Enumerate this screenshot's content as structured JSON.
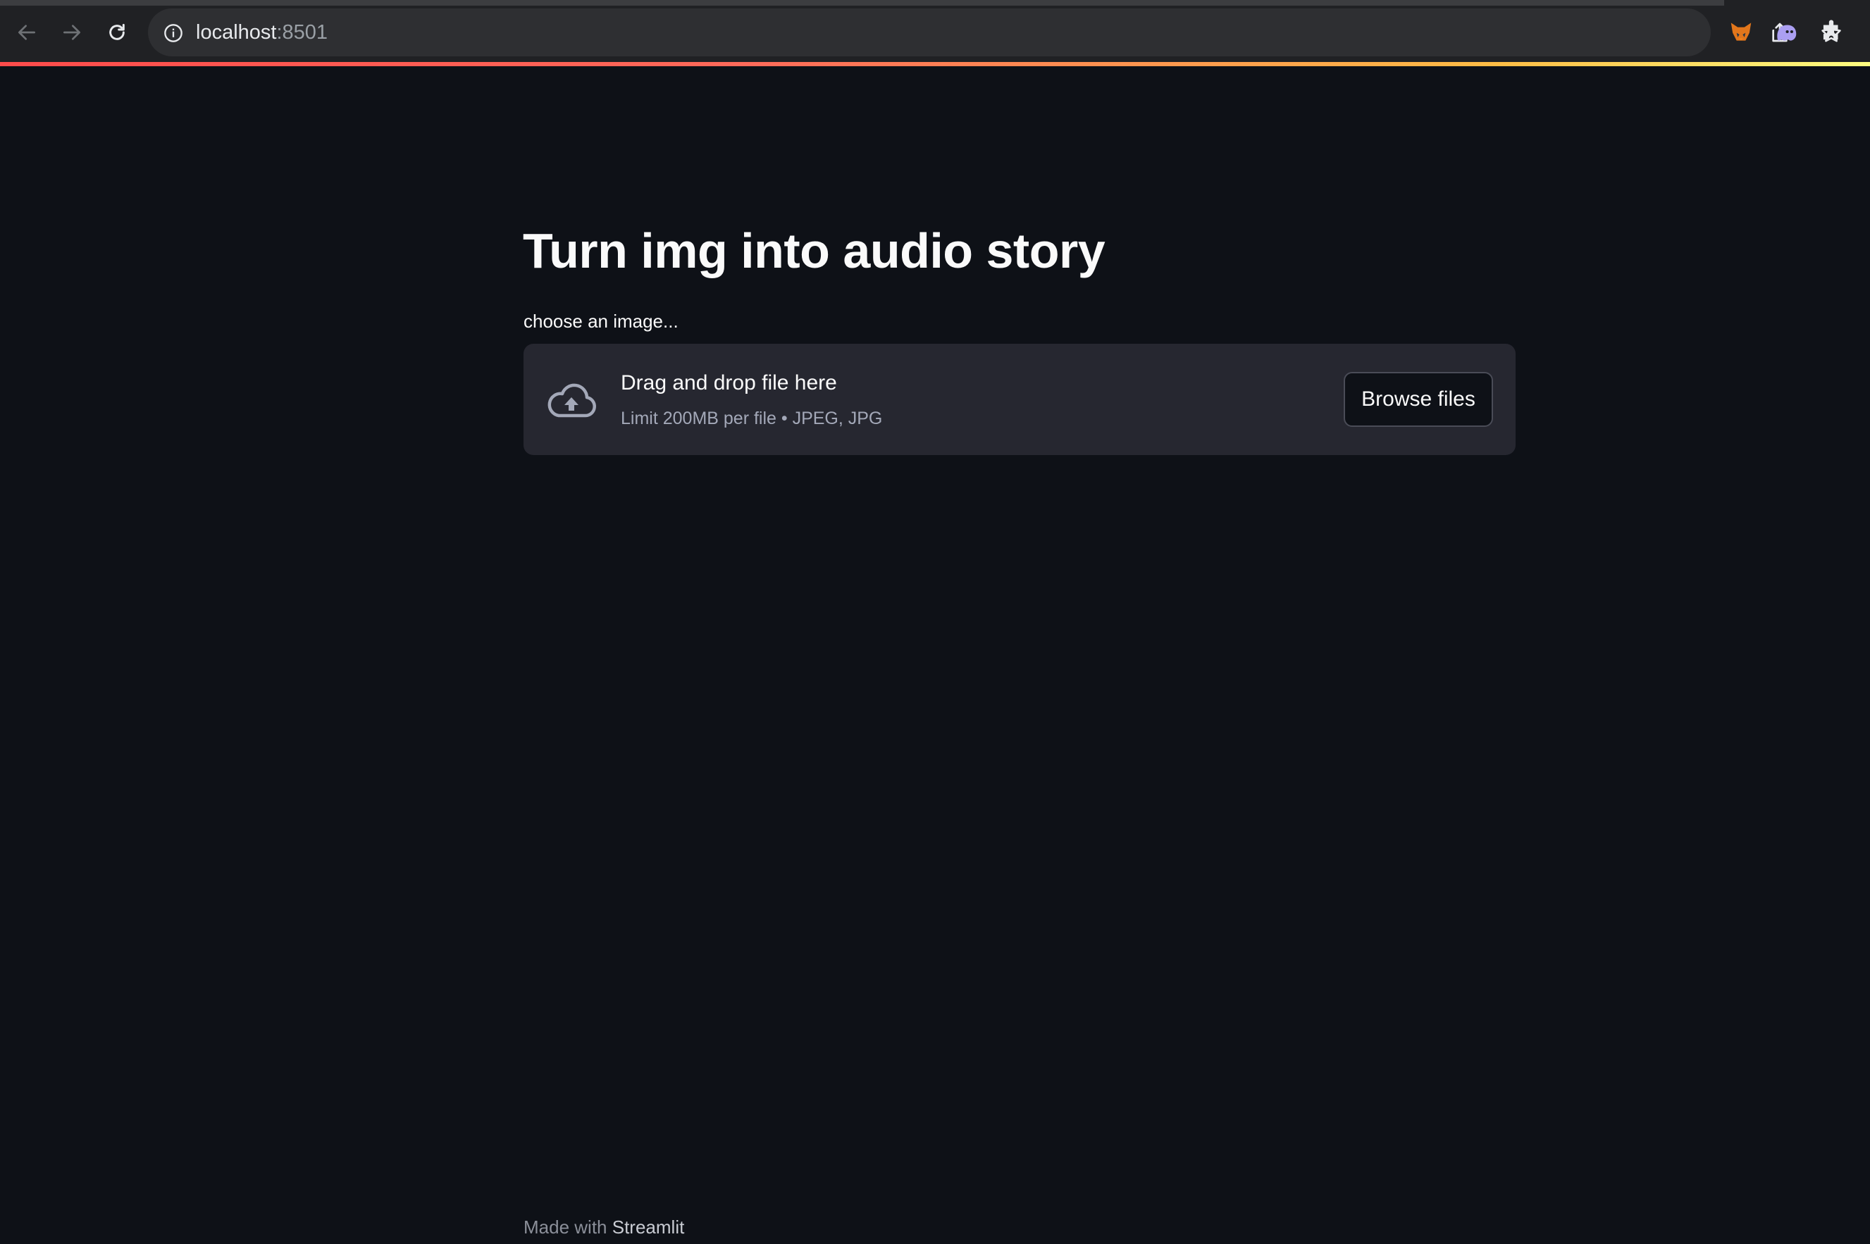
{
  "browser": {
    "url_host": "localhost",
    "url_port": ":8501",
    "icons": {
      "back": "back-arrow-icon",
      "forward": "forward-arrow-icon",
      "reload": "reload-icon",
      "info": "info-icon",
      "share": "share-icon",
      "bookmark": "star-icon",
      "extensions": [
        "fox-extension-icon",
        "ghost-extension-icon",
        "puzzle-extensions-icon"
      ]
    },
    "accent_gradient": [
      "#ff4b4b",
      "#ffbd45",
      "#fffd80"
    ]
  },
  "main": {
    "title": "Turn img into audio story",
    "uploader": {
      "label": "choose an image...",
      "drop_text": "Drag and drop file here",
      "limit_text": "Limit 200MB per file • JPEG, JPG",
      "browse_label": "Browse files",
      "icon": "cloud-upload-icon"
    }
  },
  "footer": {
    "made_with": "Made with ",
    "brand": "Streamlit"
  },
  "colors": {
    "background": "#0e1117",
    "dropzone": "#262730",
    "text": "#fafafa",
    "muted": "#a3a8b8"
  }
}
